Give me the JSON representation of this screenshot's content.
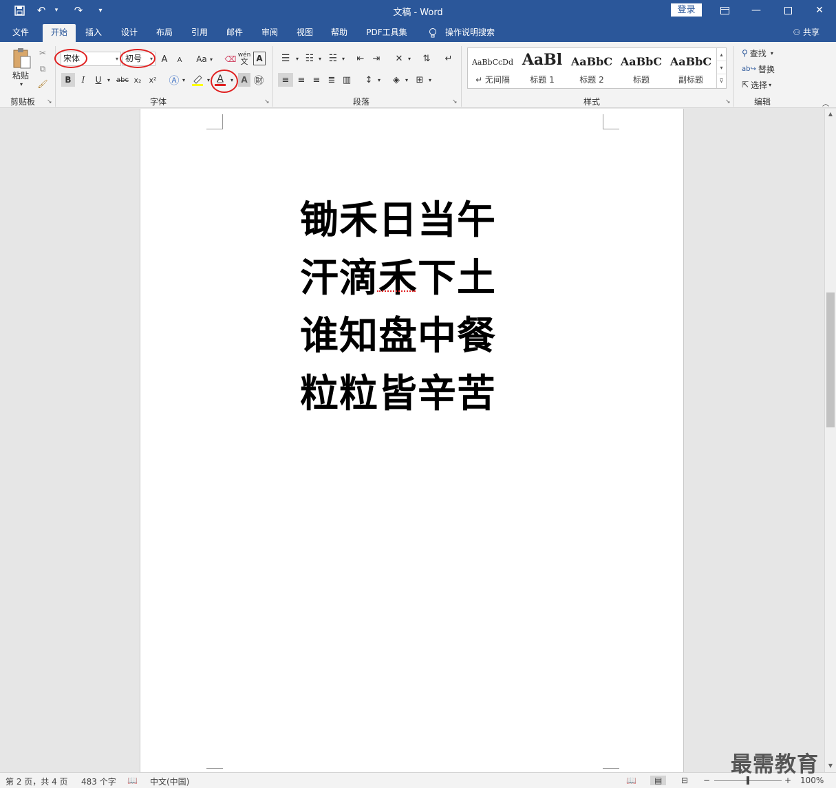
{
  "titlebar": {
    "title": "文稿  -  Word",
    "login_label": "登录",
    "bg_color": "#2b579a"
  },
  "quick_access": [
    {
      "icon": "save-icon"
    },
    {
      "icon": "undo-icon"
    },
    {
      "icon": "redo-icon"
    },
    {
      "icon": "customize-icon"
    }
  ],
  "tabs": [
    {
      "label": "文件"
    },
    {
      "label": "开始",
      "active": true
    },
    {
      "label": "插入"
    },
    {
      "label": "设计"
    },
    {
      "label": "布局"
    },
    {
      "label": "引用"
    },
    {
      "label": "邮件"
    },
    {
      "label": "审阅"
    },
    {
      "label": "视图"
    },
    {
      "label": "帮助"
    },
    {
      "label": "PDF工具集"
    },
    {
      "label": "操作说明搜索"
    }
  ],
  "share_label": "共享",
  "ribbon": {
    "clipboard": {
      "label": "剪贴板",
      "paste_label": "粘贴"
    },
    "font": {
      "label": "字体",
      "font_name": "宋体",
      "font_size": "初号",
      "bold": "B",
      "italic": "I",
      "underline": "U",
      "strike": "abc",
      "subscript": "x₂",
      "superscript": "x²",
      "case": "Aa",
      "grow": "A",
      "shrink": "A",
      "pinyin_top": "wén",
      "pinyin_bottom": "文",
      "font_color_letter": "A",
      "font_color": "#e02020",
      "highlight_color": "#ffff00"
    },
    "paragraph": {
      "label": "段落"
    },
    "styles": {
      "label": "样式",
      "items": [
        {
          "preview": "AaBbCcDd",
          "name": "↵ 无间隔"
        },
        {
          "preview": "AaBl",
          "name": "标题 1"
        },
        {
          "preview": "AaBbC",
          "name": "标题 2"
        },
        {
          "preview": "AaBbC",
          "name": "标题"
        },
        {
          "preview": "AaBbC",
          "name": "副标题"
        }
      ]
    },
    "editing": {
      "label": "编辑",
      "find": "查找",
      "replace": "替换",
      "select": "选择"
    }
  },
  "document": {
    "lines": [
      "锄禾日当午",
      "汗滴禾下土",
      "谁知盘中餐",
      "粒粒皆辛苦"
    ]
  },
  "statusbar": {
    "page": "第 2 页，共 4 页",
    "words": "483 个字",
    "language": "中文(中国)",
    "zoom": "100%",
    "zoom_minus": "−",
    "zoom_plus": "+"
  },
  "watermark": "最需教育"
}
